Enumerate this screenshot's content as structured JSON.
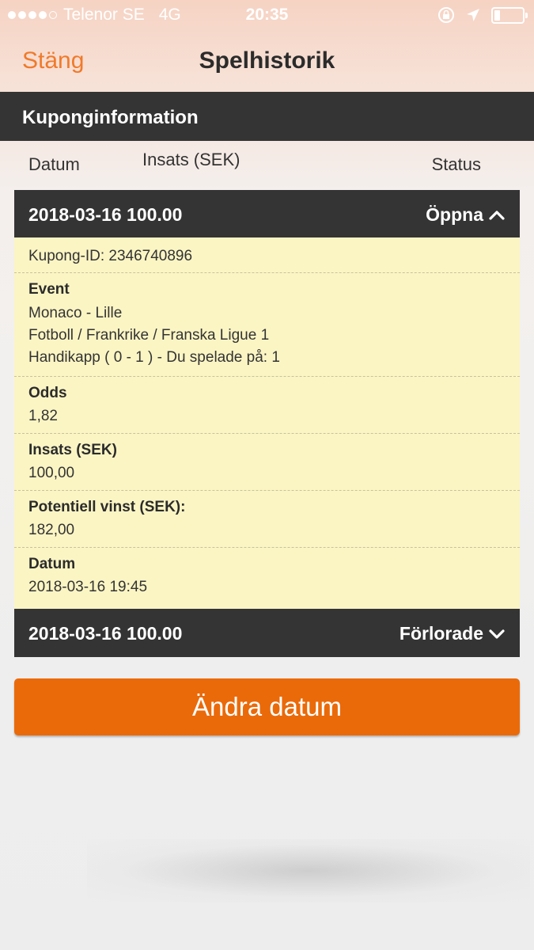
{
  "status_bar": {
    "carrier": "Telenor SE",
    "network": "4G",
    "time": "20:35",
    "signal_bars": 4,
    "signal_max": 5,
    "battery_level": 0.2
  },
  "nav": {
    "close_label": "Stäng",
    "title": "Spelhistorik"
  },
  "section": {
    "title": "Kuponginformation"
  },
  "columns": {
    "datum": "Datum",
    "insats": "Insats (SEK)",
    "status": "Status"
  },
  "coupons": [
    {
      "summary": "2018-03-16 100.00",
      "status": "Öppna",
      "expanded": true
    },
    {
      "summary": "2018-03-16 100.00",
      "status": "Förlorade",
      "expanded": false
    }
  ],
  "details": {
    "coupon_id": "Kupong-ID: 2346740896",
    "event_label": "Event",
    "event_line1": "Monaco - Lille",
    "event_line2": "Fotboll / Frankrike / Franska Ligue 1",
    "event_line3": "Handikapp ( 0 - 1 ) - Du spelade på: 1",
    "odds_label": "Odds",
    "odds_value": "1,82",
    "stake_label": "Insats (SEK)",
    "stake_value": "100,00",
    "win_label": "Potentiell vinst (SEK):",
    "win_value": "182,00",
    "date_label": "Datum",
    "date_value": "2018-03-16 19:45"
  },
  "actions": {
    "change_date": "Ändra datum"
  },
  "colors": {
    "accent": "#ea6a0a",
    "header_dark": "#343434",
    "detail_bg": "#fbf5c4"
  }
}
